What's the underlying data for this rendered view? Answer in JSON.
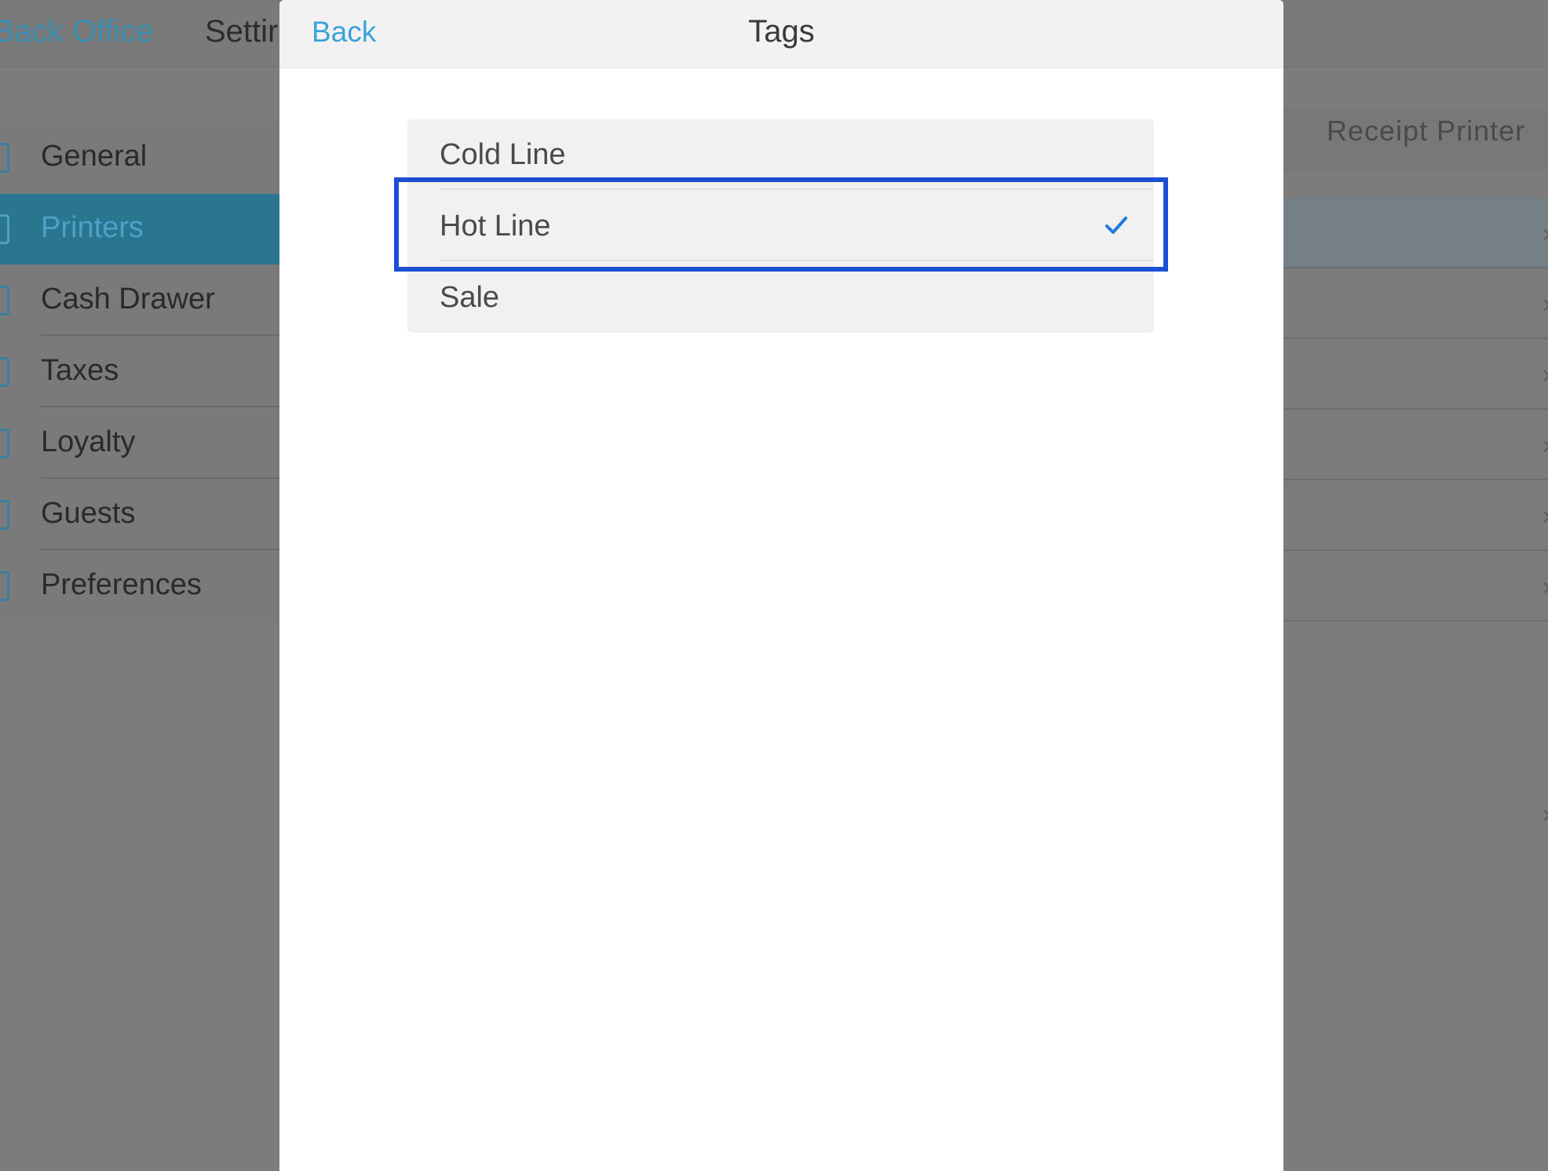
{
  "topbar": {
    "back_office": "Back Office",
    "settings": "Settir"
  },
  "sidebar": {
    "items": [
      {
        "label": "General",
        "icon": "document-icon",
        "active": false
      },
      {
        "label": "Printers",
        "icon": "printer-icon",
        "active": true
      },
      {
        "label": "Cash Drawer",
        "icon": "cash-drawer-icon",
        "active": false
      },
      {
        "label": "Taxes",
        "icon": "taxes-icon",
        "active": false
      },
      {
        "label": "Loyalty",
        "icon": "loyalty-icon",
        "active": false
      },
      {
        "label": "Guests",
        "icon": "guests-icon",
        "active": false
      },
      {
        "label": "Preferences",
        "icon": "preferences-icon",
        "active": false
      }
    ]
  },
  "right_panel": {
    "header": "Receipt Printer"
  },
  "modal": {
    "back_label": "Back",
    "title": "Tags",
    "tags": [
      {
        "label": "Cold Line",
        "selected": false
      },
      {
        "label": "Hot Line",
        "selected": true
      },
      {
        "label": "Sale",
        "selected": false
      }
    ]
  },
  "colors": {
    "accent": "#39a3d8",
    "highlight_border": "#1b4fd6",
    "checkmark": "#1f7ae0",
    "active_sidebar": "#2a7590"
  }
}
